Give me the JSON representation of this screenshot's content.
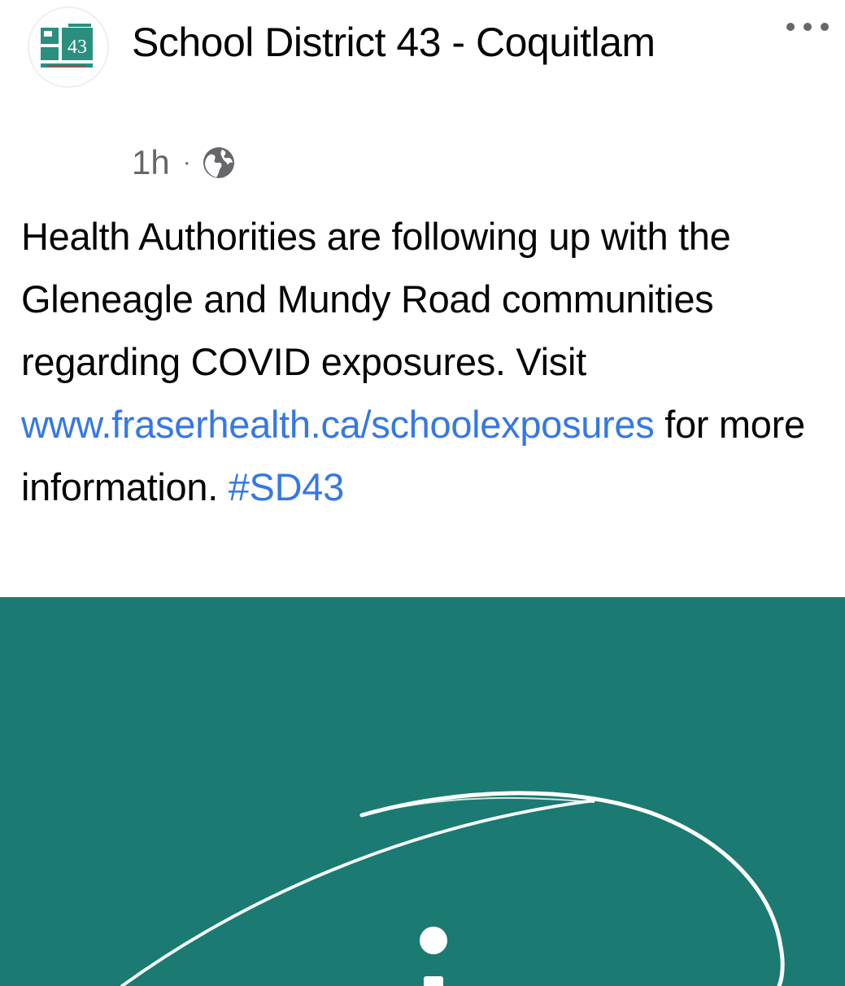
{
  "post": {
    "page_name": "School District 43 - Coquitlam",
    "avatar_text": "43",
    "timestamp": "1h",
    "separator": "·",
    "privacy_icon": "globe-icon",
    "more_icon": "more-options-icon",
    "body": {
      "text_1": "Health Authorities are following up with the Gleneagle and Mundy Road communities regarding COVID exposures. Visit ",
      "link": "www.fraserhealth.ca/schoolexposures",
      "text_2": " for more information. ",
      "hashtag": "#SD43"
    },
    "image": {
      "background_color": "#1b7a72",
      "icon": "info-icon"
    }
  },
  "colors": {
    "link": "#3578e5",
    "meta_text": "#65676b",
    "primary_text": "#050505"
  }
}
